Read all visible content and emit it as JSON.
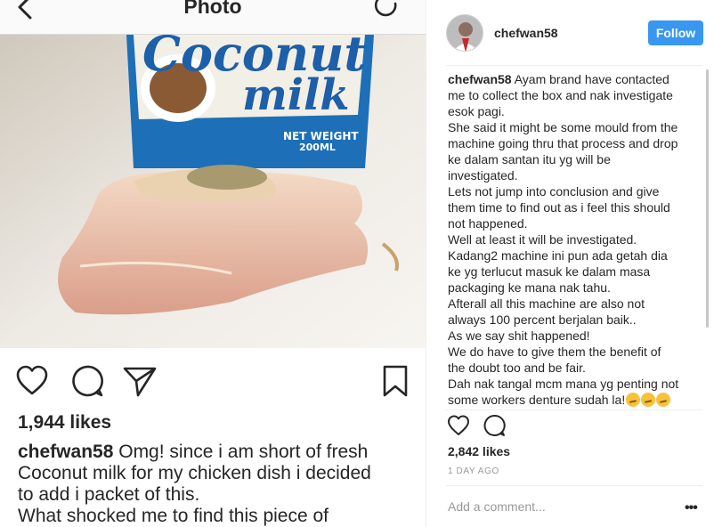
{
  "left": {
    "title": "Photo",
    "icons": {
      "back": "chevron-left-icon",
      "refresh": "refresh-icon",
      "like": "heart-icon",
      "comment": "comment-icon",
      "share": "send-icon",
      "save": "bookmark-icon"
    },
    "photo": {
      "alt": "coconut-milk-photo",
      "carton_brand": "Coconut",
      "carton_product": "milk",
      "net_weight_label": "NET WEIGHT",
      "net_weight_value": "200ML"
    },
    "likes": "1,944 likes",
    "caption": {
      "username": "chefwan58",
      "line1": "Omg!  since i am short of fresh",
      "line2": "Coconut milk for my chicken dish i decided",
      "line3": "to add i packet of this.",
      "line4": "What shocked me to find this piece of"
    }
  },
  "right": {
    "username": "chefwan58",
    "follow_label": "Follow",
    "comment": {
      "username": "chefwan58",
      "lines": [
        "Ayam brand have contacted",
        "me to collect the box and nak investigate",
        "esok pagi.",
        "She said it might be some mould from the",
        "machine going thru that process and drop",
        "ke dalam santan itu yg will be",
        "investigated.",
        "Lets not jump into conclusion and give",
        "them time to find out as i feel this should",
        "not happened.",
        "Well at least it will be investigated.",
        "Kadang2 machine ini pun ada getah dia",
        "ke yg terlucut masuk ke dalam masa",
        "packaging ke mana nak tahu.",
        "Afterall all this machine are also not",
        "always 100 percent berjalan baik..",
        "As we say shit happened!",
        "We do have to give them the benefit of",
        "the doubt too and be fair.",
        "Dah nak tangal mcm mana yg penting not",
        "some workers denture sudah la!"
      ]
    },
    "icons": {
      "like": "heart-icon",
      "comment": "comment-icon",
      "more": "more-icon",
      "emoji": "face-with-hand-over-mouth-icon"
    },
    "likes": "2,842 likes",
    "time": "1 DAY AGO",
    "add_comment_placeholder": "Add a comment...",
    "more_label": "•••",
    "colors": {
      "follow_button": "#3897f0",
      "muted_text": "#999999"
    }
  }
}
